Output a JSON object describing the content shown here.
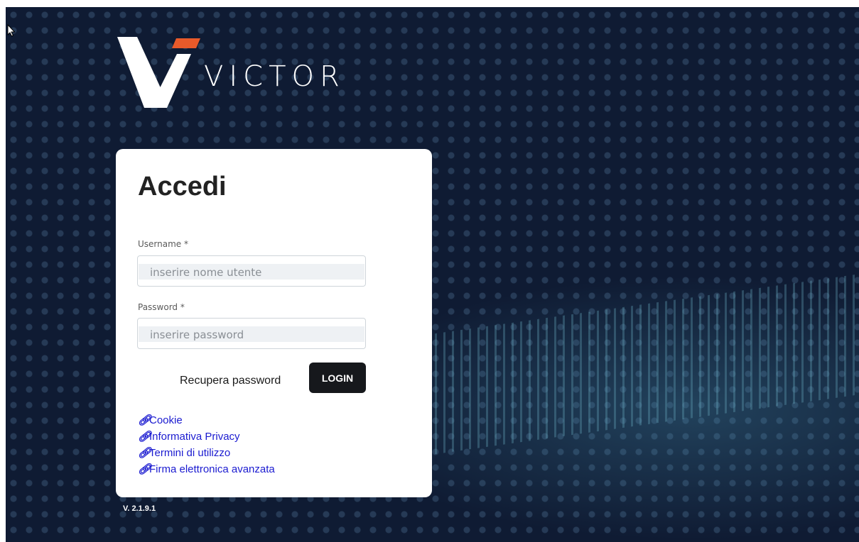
{
  "brand": {
    "name": "VICTOR",
    "accent": "#e85a2a"
  },
  "login": {
    "title": "Accedi",
    "username_label": "Username *",
    "username_placeholder": "inserire nome utente",
    "password_label": "Password *",
    "password_placeholder": "inserire password",
    "recover_label": "Recupera password",
    "login_label": "LOGIN"
  },
  "links": [
    {
      "label": "Cookie",
      "icon": "link-icon"
    },
    {
      "label": "Informativa Privacy",
      "icon": "link-icon"
    },
    {
      "label": "Termini di utilizzo",
      "icon": "link-icon"
    },
    {
      "label": "Firma elettronica avanzata",
      "icon": "link-icon"
    }
  ],
  "version": "V. 2.1.9.1",
  "colors": {
    "background": "#0f1b33",
    "button": "#16181c",
    "link": "#1b1bd0"
  }
}
